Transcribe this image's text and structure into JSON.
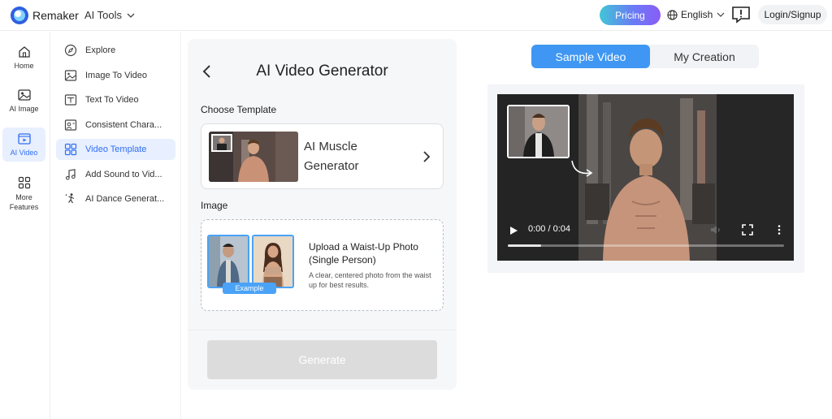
{
  "header": {
    "brand": "Remaker",
    "tools_label": "AI Tools",
    "pricing_label": "Pricing",
    "language_label": "English",
    "login_label": "Login/Signup"
  },
  "sidebar": {
    "items": [
      {
        "label": "Home",
        "icon": "home-icon"
      },
      {
        "label": "AI Image",
        "icon": "image-icon"
      },
      {
        "label": "AI Video",
        "icon": "video-icon",
        "active": true
      },
      {
        "label": "More Features",
        "icon": "grid-icon"
      }
    ]
  },
  "subnav": {
    "items": [
      {
        "label": "Explore",
        "icon": "compass-icon"
      },
      {
        "label": "Image To Video",
        "icon": "image-video-icon"
      },
      {
        "label": "Text To Video",
        "icon": "text-video-icon"
      },
      {
        "label": "Consistent Chara...",
        "icon": "character-icon"
      },
      {
        "label": "Video Template",
        "icon": "template-icon",
        "active": true
      },
      {
        "label": "Add Sound to Vid...",
        "icon": "music-icon"
      },
      {
        "label": "AI Dance Generat...",
        "icon": "dance-icon"
      }
    ]
  },
  "panel": {
    "title": "AI Video Generator",
    "choose_label": "Choose Template",
    "template_name": "AI Muscle Generator",
    "image_label": "Image",
    "upload_title": "Upload a Waist-Up Photo (Single Person)",
    "upload_desc": "A clear, centered photo from the waist up for best results.",
    "example_label": "Example",
    "generate_label": "Generate"
  },
  "preview": {
    "tab_sample": "Sample Video",
    "tab_creation": "My Creation",
    "time": "0:00 / 0:04",
    "progress": 0.12
  },
  "colors": {
    "accent": "#3f97f3",
    "nav_active_bg": "#e8effe",
    "nav_active_text": "#2f6ef5"
  }
}
